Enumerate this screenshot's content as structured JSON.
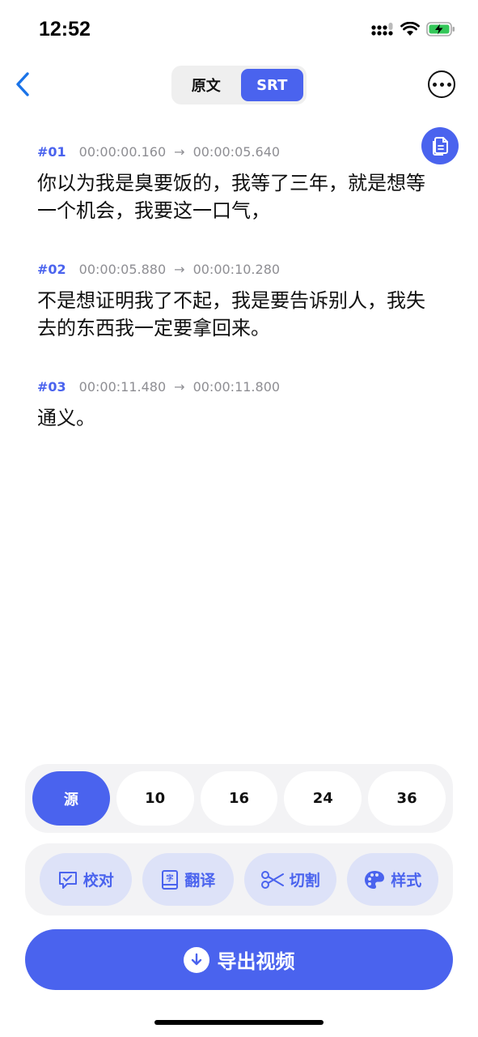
{
  "status_bar": {
    "time": "12:52"
  },
  "header": {
    "segments": [
      {
        "label": "原文",
        "active": false
      },
      {
        "label": "SRT",
        "active": true
      }
    ]
  },
  "entries": [
    {
      "num": "#01",
      "start": "00:00:00.160",
      "arrow": "→",
      "end": "00:00:05.640",
      "text": "你以为我是臭要饭的，我等了三年，就是想等一个机会，我要这一口气，"
    },
    {
      "num": "#02",
      "start": "00:00:05.880",
      "arrow": "→",
      "end": "00:00:10.280",
      "text": "不是想证明我了不起，我是要告诉别人，我失去的东西我一定要拿回来。"
    },
    {
      "num": "#03",
      "start": "00:00:11.480",
      "arrow": "→",
      "end": "00:00:11.800",
      "text": "通义。"
    }
  ],
  "size_options": [
    "源",
    "10",
    "16",
    "24",
    "36"
  ],
  "tools": [
    {
      "label": "校对",
      "icon": "proofread-icon"
    },
    {
      "label": "翻译",
      "icon": "translate-icon"
    },
    {
      "label": "切割",
      "icon": "scissors-icon"
    },
    {
      "label": "样式",
      "icon": "palette-icon"
    }
  ],
  "export": {
    "label": "导出视频",
    "icon": "download-icon"
  },
  "colors": {
    "accent": "#4a63ee",
    "accent_light": "#dde2f8",
    "panel": "#f3f3f5"
  }
}
